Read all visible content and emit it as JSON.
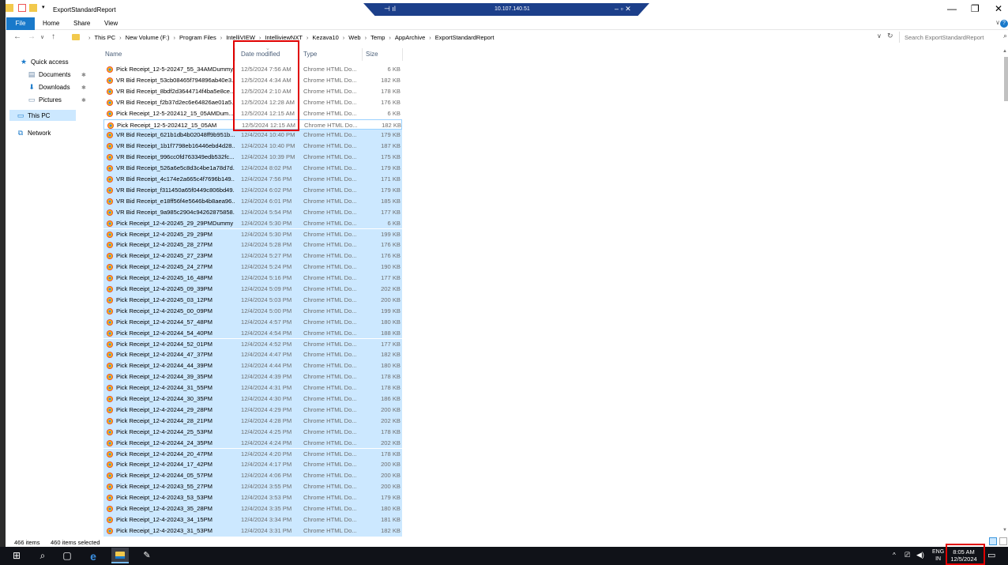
{
  "window": {
    "title": "ExportStandardReport",
    "remote_session": {
      "ip": "10.107.140.51",
      "pin_glyph": "⊣ ıl",
      "controls_glyph": "–  ▫  ✕"
    },
    "controls": {
      "minimize": "—",
      "maximize": "❐",
      "close": "✕"
    }
  },
  "ribbon": {
    "tabs": [
      "File",
      "Home",
      "Share",
      "View"
    ]
  },
  "address": {
    "breadcrumb": [
      "This PC",
      "New Volume (F:)",
      "Program Files",
      "IntelliVIEW",
      "IntelliviewNXT",
      "Kezava10",
      "Web",
      "Temp",
      "AppArchive",
      "ExportStandardReport"
    ],
    "search_placeholder": "Search ExportStandardReport"
  },
  "nav": {
    "quick_access": "Quick access",
    "documents": "Documents",
    "downloads": "Downloads",
    "pictures": "Pictures",
    "this_pc": "This PC",
    "network": "Network"
  },
  "columns": {
    "name": "Name",
    "date": "Date modified",
    "type": "Type",
    "size": "Size"
  },
  "files": [
    {
      "name": "Pick Receipt_12-5-20247_55_34AMDummy",
      "date": "12/5/2024 7:56 AM",
      "type": "Chrome HTML Do...",
      "size": "6 KB",
      "state": "normal"
    },
    {
      "name": "VR Bid Receipt_53cb08465f794896ab40e3...",
      "date": "12/5/2024 4:34 AM",
      "type": "Chrome HTML Do...",
      "size": "182 KB",
      "state": "normal"
    },
    {
      "name": "VR Bid Receipt_8bdf2d3644714f4ba5e8ce...",
      "date": "12/5/2024 2:10 AM",
      "type": "Chrome HTML Do...",
      "size": "178 KB",
      "state": "normal"
    },
    {
      "name": "VR Bid Receipt_f2b37d2ec6e64826ae01a5...",
      "date": "12/5/2024 12:28 AM",
      "type": "Chrome HTML Do...",
      "size": "176 KB",
      "state": "normal"
    },
    {
      "name": "Pick Receipt_12-5-202412_15_05AMDum...",
      "date": "12/5/2024 12:15 AM",
      "type": "Chrome HTML Do...",
      "size": "6 KB",
      "state": "normal"
    },
    {
      "name": "Pick Receipt_12-5-202412_15_05AM",
      "date": "12/5/2024 12:15 AM",
      "type": "Chrome HTML Do...",
      "size": "182 KB",
      "state": "focused"
    },
    {
      "name": "VR Bid Receipt_621b1db4b02048ff9b951b...",
      "date": "12/4/2024 10:40 PM",
      "type": "Chrome HTML Do...",
      "size": "179 KB",
      "state": "selected"
    },
    {
      "name": "VR Bid Receipt_1b1f7798eb16446ebd4d28...",
      "date": "12/4/2024 10:40 PM",
      "type": "Chrome HTML Do...",
      "size": "187 KB",
      "state": "selected"
    },
    {
      "name": "VR Bid Receipt_996cc0fd763349edb532fc...",
      "date": "12/4/2024 10:39 PM",
      "type": "Chrome HTML Do...",
      "size": "175 KB",
      "state": "selected"
    },
    {
      "name": "VR Bid Receipt_526a6e5c8d3c4be1a78d7d...",
      "date": "12/4/2024 8:02 PM",
      "type": "Chrome HTML Do...",
      "size": "179 KB",
      "state": "selected"
    },
    {
      "name": "VR Bid Receipt_4c174e2a665c4f7696b149...",
      "date": "12/4/2024 7:56 PM",
      "type": "Chrome HTML Do...",
      "size": "171 KB",
      "state": "selected"
    },
    {
      "name": "VR Bid Receipt_f311450a65f0449c806bd49...",
      "date": "12/4/2024 6:02 PM",
      "type": "Chrome HTML Do...",
      "size": "179 KB",
      "state": "selected"
    },
    {
      "name": "VR Bid Receipt_e18ff56f4e5646b4b8aea96...",
      "date": "12/4/2024 6:01 PM",
      "type": "Chrome HTML Do...",
      "size": "185 KB",
      "state": "selected"
    },
    {
      "name": "VR Bid Receipt_9a985c2904c94262875858...",
      "date": "12/4/2024 5:54 PM",
      "type": "Chrome HTML Do...",
      "size": "177 KB",
      "state": "selected"
    },
    {
      "name": "Pick Receipt_12-4-20245_29_29PMDummy",
      "date": "12/4/2024 5:30 PM",
      "type": "Chrome HTML Do...",
      "size": "6 KB",
      "state": "selected"
    },
    {
      "name": "Pick Receipt_12-4-20245_29_29PM",
      "date": "12/4/2024 5:30 PM",
      "type": "Chrome HTML Do...",
      "size": "199 KB",
      "state": "selected"
    },
    {
      "name": "Pick Receipt_12-4-20245_28_27PM",
      "date": "12/4/2024 5:28 PM",
      "type": "Chrome HTML Do...",
      "size": "176 KB",
      "state": "selected"
    },
    {
      "name": "Pick Receipt_12-4-20245_27_23PM",
      "date": "12/4/2024 5:27 PM",
      "type": "Chrome HTML Do...",
      "size": "176 KB",
      "state": "selected"
    },
    {
      "name": "Pick Receipt_12-4-20245_24_27PM",
      "date": "12/4/2024 5:24 PM",
      "type": "Chrome HTML Do...",
      "size": "190 KB",
      "state": "selected"
    },
    {
      "name": "Pick Receipt_12-4-20245_16_48PM",
      "date": "12/4/2024 5:16 PM",
      "type": "Chrome HTML Do...",
      "size": "177 KB",
      "state": "selected"
    },
    {
      "name": "Pick Receipt_12-4-20245_09_39PM",
      "date": "12/4/2024 5:09 PM",
      "type": "Chrome HTML Do...",
      "size": "202 KB",
      "state": "selected"
    },
    {
      "name": "Pick Receipt_12-4-20245_03_12PM",
      "date": "12/4/2024 5:03 PM",
      "type": "Chrome HTML Do...",
      "size": "200 KB",
      "state": "selected"
    },
    {
      "name": "Pick Receipt_12-4-20245_00_09PM",
      "date": "12/4/2024 5:00 PM",
      "type": "Chrome HTML Do...",
      "size": "199 KB",
      "state": "selected"
    },
    {
      "name": "Pick Receipt_12-4-20244_57_48PM",
      "date": "12/4/2024 4:57 PM",
      "type": "Chrome HTML Do...",
      "size": "180 KB",
      "state": "selected"
    },
    {
      "name": "Pick Receipt_12-4-20244_54_40PM",
      "date": "12/4/2024 4:54 PM",
      "type": "Chrome HTML Do...",
      "size": "188 KB",
      "state": "selected"
    },
    {
      "name": "Pick Receipt_12-4-20244_52_01PM",
      "date": "12/4/2024 4:52 PM",
      "type": "Chrome HTML Do...",
      "size": "177 KB",
      "state": "selected"
    },
    {
      "name": "Pick Receipt_12-4-20244_47_37PM",
      "date": "12/4/2024 4:47 PM",
      "type": "Chrome HTML Do...",
      "size": "182 KB",
      "state": "selected"
    },
    {
      "name": "Pick Receipt_12-4-20244_44_39PM",
      "date": "12/4/2024 4:44 PM",
      "type": "Chrome HTML Do...",
      "size": "180 KB",
      "state": "selected"
    },
    {
      "name": "Pick Receipt_12-4-20244_39_35PM",
      "date": "12/4/2024 4:39 PM",
      "type": "Chrome HTML Do...",
      "size": "178 KB",
      "state": "selected"
    },
    {
      "name": "Pick Receipt_12-4-20244_31_55PM",
      "date": "12/4/2024 4:31 PM",
      "type": "Chrome HTML Do...",
      "size": "178 KB",
      "state": "selected"
    },
    {
      "name": "Pick Receipt_12-4-20244_30_35PM",
      "date": "12/4/2024 4:30 PM",
      "type": "Chrome HTML Do...",
      "size": "186 KB",
      "state": "selected"
    },
    {
      "name": "Pick Receipt_12-4-20244_29_28PM",
      "date": "12/4/2024 4:29 PM",
      "type": "Chrome HTML Do...",
      "size": "200 KB",
      "state": "selected"
    },
    {
      "name": "Pick Receipt_12-4-20244_28_21PM",
      "date": "12/4/2024 4:28 PM",
      "type": "Chrome HTML Do...",
      "size": "202 KB",
      "state": "selected"
    },
    {
      "name": "Pick Receipt_12-4-20244_25_53PM",
      "date": "12/4/2024 4:25 PM",
      "type": "Chrome HTML Do...",
      "size": "178 KB",
      "state": "selected"
    },
    {
      "name": "Pick Receipt_12-4-20244_24_35PM",
      "date": "12/4/2024 4:24 PM",
      "type": "Chrome HTML Do...",
      "size": "202 KB",
      "state": "selected"
    },
    {
      "name": "Pick Receipt_12-4-20244_20_47PM",
      "date": "12/4/2024 4:20 PM",
      "type": "Chrome HTML Do...",
      "size": "178 KB",
      "state": "selected"
    },
    {
      "name": "Pick Receipt_12-4-20244_17_42PM",
      "date": "12/4/2024 4:17 PM",
      "type": "Chrome HTML Do...",
      "size": "200 KB",
      "state": "selected"
    },
    {
      "name": "Pick Receipt_12-4-20244_05_57PM",
      "date": "12/4/2024 4:06 PM",
      "type": "Chrome HTML Do...",
      "size": "200 KB",
      "state": "selected"
    },
    {
      "name": "Pick Receipt_12-4-20243_55_27PM",
      "date": "12/4/2024 3:55 PM",
      "type": "Chrome HTML Do...",
      "size": "200 KB",
      "state": "selected"
    },
    {
      "name": "Pick Receipt_12-4-20243_53_53PM",
      "date": "12/4/2024 3:53 PM",
      "type": "Chrome HTML Do...",
      "size": "179 KB",
      "state": "selected"
    },
    {
      "name": "Pick Receipt_12-4-20243_35_28PM",
      "date": "12/4/2024 3:35 PM",
      "type": "Chrome HTML Do...",
      "size": "180 KB",
      "state": "selected"
    },
    {
      "name": "Pick Receipt_12-4-20243_34_15PM",
      "date": "12/4/2024 3:34 PM",
      "type": "Chrome HTML Do...",
      "size": "181 KB",
      "state": "selected"
    },
    {
      "name": "Pick Receipt_12-4-20243_31_53PM",
      "date": "12/4/2024 3:31 PM",
      "type": "Chrome HTML Do...",
      "size": "182 KB",
      "state": "selected"
    }
  ],
  "status": {
    "items": "466 items",
    "selected": "460 items selected"
  },
  "taskbar": {
    "lang_line1": "ENG",
    "lang_line2": "IN",
    "time": "8:05 AM",
    "date": "12/5/2024"
  },
  "colors": {
    "accent": "#1979ca",
    "selection": "#cce8ff",
    "highlight_box": "#e00000",
    "rdp_bar": "#1c3f8a"
  }
}
